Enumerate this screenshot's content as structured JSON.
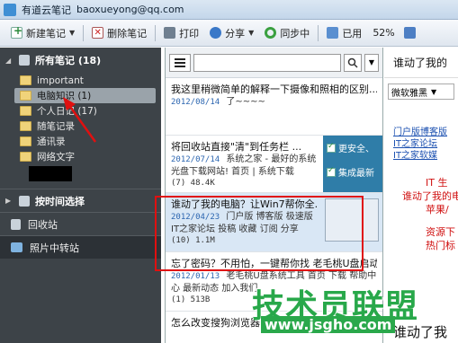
{
  "window": {
    "title": "有道云笔记",
    "account": "baoxueyong@qq.com"
  },
  "toolbar": {
    "new_note": "新建笔记",
    "delete_note": "删除笔记",
    "print": "打印",
    "share": "分享",
    "sync": "同步中",
    "used": "已用",
    "used_pct": "52%"
  },
  "sidebar": {
    "header": "所有笔记 (18)",
    "items": [
      {
        "label": "important"
      },
      {
        "label": "电脑知识 (1)"
      },
      {
        "label": "个人日记 (17)"
      },
      {
        "label": "随笔记录"
      },
      {
        "label": "通讯录"
      },
      {
        "label": "网络文字"
      }
    ],
    "by_time": "按时间选择",
    "trash": "回收站",
    "photo_transfer": "照片中转站"
  },
  "search": {
    "placeholder": ""
  },
  "notes": [
    {
      "title": "我这里稍微简单的解释一下摄像和照相的区别...",
      "date": "2012/08/14",
      "snippet": "了~~~~",
      "meta": ""
    },
    {
      "title": "将回收站直接\"清\"到任务栏 ...",
      "date": "2012/07/14",
      "snippet": "系统之家 - 最好的系统光盘下载网站! 首页 | 系统下载",
      "meta": "(7) 48.4K"
    },
    {
      "title": "谁动了我的电脑？让Win7帮你全...",
      "date": "2012/04/23",
      "snippet": "门户版 博客版 极速版 IT之家论坛 投稿 收藏 订阅 分享",
      "meta": "(10) 1.1M"
    },
    {
      "title": "忘了密码？不用怕，一键帮你找 老毛桃U盘启动...",
      "date": "2012/01/13",
      "snippet": "老毛桃U盘系统工具 首页 下载 帮助中心 最新动态 加入我们",
      "meta": "(1) 513B"
    },
    {
      "title": "怎么改变搜狗浏览器...",
      "date": "",
      "snippet": "",
      "meta": ""
    }
  ],
  "thumb_items": [
    "更安全、",
    "集成最新"
  ],
  "right": {
    "title": "谁动了我的",
    "font": "微软雅黑",
    "links": [
      "门户版博客版",
      "IT之家论坛",
      "IT之家软媒"
    ],
    "red_lines": [
      "IT 生",
      "谁动了我的电脑",
      "苹果/",
      "资源下",
      "热门标"
    ],
    "bottom_title": "谁动了我"
  },
  "watermark": {
    "text": "技术员联盟",
    "url": "www.jsgho.com"
  },
  "colors": {
    "sidebar_bg": "#3d4348",
    "annotation_red": "#e01010",
    "watermark_green": "#28a84a"
  }
}
